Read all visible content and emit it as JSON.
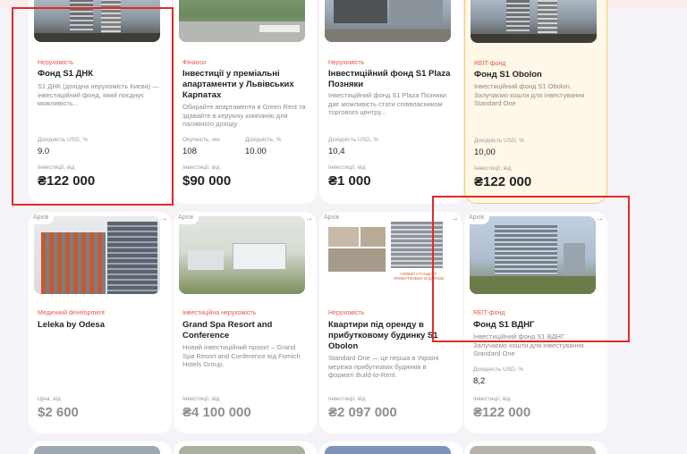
{
  "cards_row1": [
    {
      "category": "Нерухомість",
      "title": "Фонд S1 ДНК",
      "description": "S1 ДНК (дохідна нерухомість Києва) — інвестиційний фонд, який поєднує можливість...",
      "yield_label": "Дохідність USD, %",
      "yield": "9.0",
      "invest_label": "Інвестиції, від",
      "invest": "₴122 000"
    },
    {
      "category": "Фінанси",
      "title": "Інвестиції у преміальні апартаменти у Львівських Карпатах",
      "description": "Обирайте апартаменти в Green Rest та здавайте в керуючу компанію для пасивного доходу",
      "payback_label": "Окупність, міс",
      "payback": "108",
      "yield_label": "Дохідність, %",
      "yield": "10.00",
      "invest_label": "Інвестиції, від",
      "invest": "$90 000"
    },
    {
      "category": "Нерухомість",
      "title": "Інвестиційний фонд S1 Plaza Позняки",
      "description": "Інвестиційний фонд S1 Plaza Позняки дає можливість стати співвласником торгового центру...",
      "yield_label": "Дохідність USD, %",
      "yield": "10,4",
      "invest_label": "Інвестиції, від",
      "invest": "₴1 000"
    },
    {
      "category": "REIT-фонд",
      "title": "Фонд S1 Obolon",
      "description": "Інвестиційний фонд S1 Obolon. Залучаємо кошти для інвестування Standard One",
      "yield_label": "Дохідність USD, %",
      "yield": "10,00",
      "invest_label": "Інвестиції, від",
      "invest": "₴122 000"
    }
  ],
  "cards_row2": [
    {
      "badge": "Архів",
      "category": "Медичний development",
      "title": "Leleka by Odesa",
      "description": "",
      "price_label": "Ціна, від",
      "price": "$2 600"
    },
    {
      "badge": "Архів",
      "category": "Інвестиційна нерухомість",
      "title": "Grand Spa Resort and Conference",
      "description": "Новий інвестиційний проєкт – Grand Spa Resort and Conference від Fomich Hotels Group.",
      "invest_label": "Інвестиції, від",
      "invest": "₴4 100 000"
    },
    {
      "badge": "Архів",
      "category": "Нерухомість",
      "title": "Квартири під оренду в прибутковому будинку S1 Obolon",
      "description": "Standard One — це перша в Україні мережа прибуткових будинків в форматі Build-to-Rent.",
      "image_caption": "НОВИЙ СТАНДАРТ ПРИБУТКОВИХ БУДИНКІВ",
      "invest_label": "Інвестиції, від",
      "invest": "₴2 097 000"
    },
    {
      "badge": "Архів",
      "category": "REIT-фонд",
      "title": "Фонд S1 ВДНГ",
      "description": "Інвестиційний фонд S1 ВДНГ. Залучаємо кошти для інвестування Standard One",
      "yield_label": "Дохідність USD, %",
      "yield": "8,2",
      "invest_label": "Інвестиції, від",
      "invest": "₴122 000"
    }
  ],
  "arrow_icon": "→",
  "colors": {
    "accent": "#e6564f",
    "featured_border": "#f3c969",
    "highlight_box": "#e12a2a"
  }
}
